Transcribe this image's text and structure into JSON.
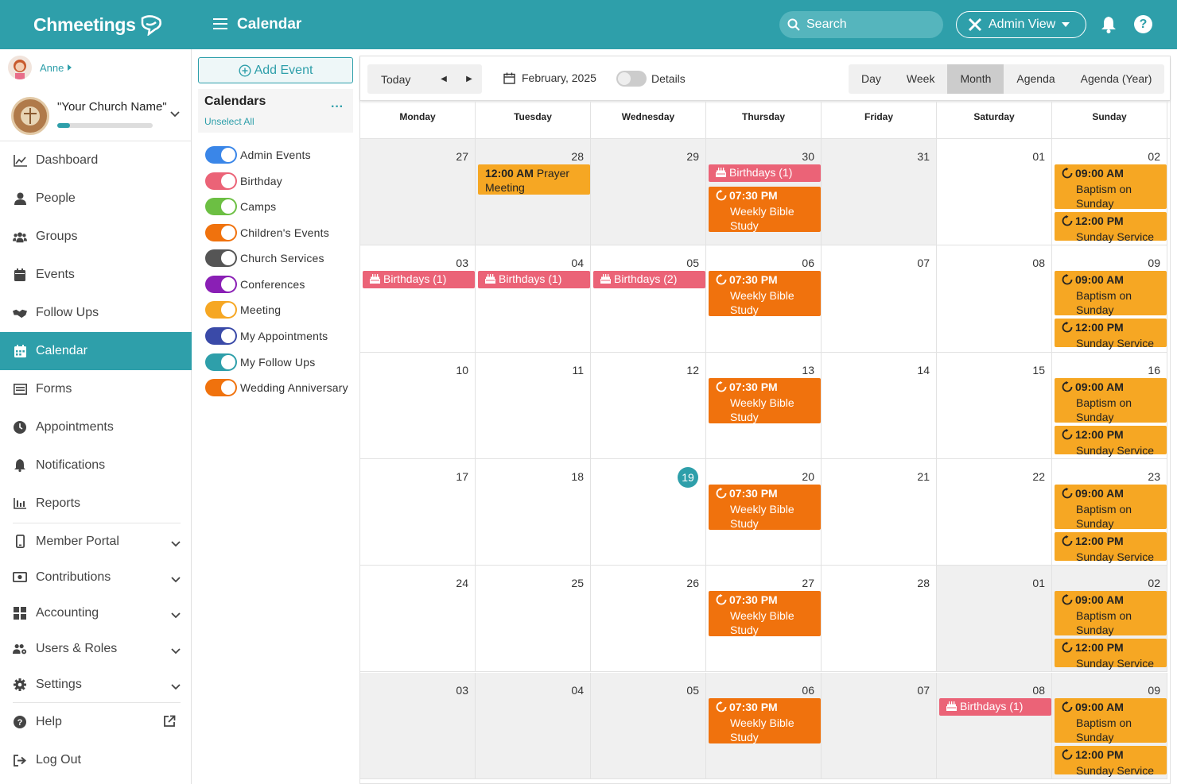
{
  "app": {
    "brand": "Chmeetings",
    "page_title": "Calendar"
  },
  "header": {
    "search_placeholder": "Search",
    "admin_view_label": "Admin View"
  },
  "user": {
    "name": "Anne"
  },
  "church": {
    "name": "\"Your Church Name\"",
    "progress": 0.13
  },
  "nav": [
    {
      "label": "Dashboard",
      "icon": "chart-line-icon"
    },
    {
      "label": "People",
      "icon": "person-icon"
    },
    {
      "label": "Groups",
      "icon": "people-group-icon"
    },
    {
      "label": "Events",
      "icon": "calendar-icon"
    },
    {
      "label": "Follow Ups",
      "icon": "handshake-icon"
    },
    {
      "label": "Calendar",
      "icon": "calendar-grid-icon",
      "active": true
    },
    {
      "label": "Forms",
      "icon": "form-list-icon"
    },
    {
      "label": "Appointments",
      "icon": "clock-icon"
    },
    {
      "label": "Notifications",
      "icon": "bell-icon"
    },
    {
      "label": "Reports",
      "icon": "bar-report-icon"
    },
    {
      "label": "Member Portal",
      "icon": "mobile-icon",
      "expandable": true
    },
    {
      "label": "Contributions",
      "icon": "money-icon",
      "expandable": true
    },
    {
      "label": "Accounting",
      "icon": "calculator-icon",
      "expandable": true
    },
    {
      "label": "Users & Roles",
      "icon": "users-cog-icon",
      "expandable": true
    },
    {
      "label": "Settings",
      "icon": "gear-icon",
      "expandable": true
    },
    {
      "label": "Help",
      "icon": "question-icon",
      "external": true
    },
    {
      "label": "Log Out",
      "icon": "logout-icon"
    }
  ],
  "calendars_panel": {
    "add_event_label": "Add Event",
    "title": "Calendars",
    "unselect_all": "Unselect All",
    "items": [
      {
        "label": "Admin Events",
        "color": "#3a86e8"
      },
      {
        "label": "Birthday",
        "color": "#eb6377"
      },
      {
        "label": "Camps",
        "color": "#6cbf43"
      },
      {
        "label": "Children's Events",
        "color": "#f0720d"
      },
      {
        "label": "Church Services",
        "color": "#555555"
      },
      {
        "label": "Conferences",
        "color": "#8a1fb5"
      },
      {
        "label": "Meeting",
        "color": "#f6a723"
      },
      {
        "label": "My Appointments",
        "color": "#3a4aa8"
      },
      {
        "label": "My Follow Ups",
        "color": "#2e9faa"
      },
      {
        "label": "Wedding Anniversary",
        "color": "#f0720d"
      }
    ]
  },
  "toolbar": {
    "today": "Today",
    "current_month": "February, 2025",
    "details_label": "Details",
    "views": [
      {
        "label": "Day"
      },
      {
        "label": "Week"
      },
      {
        "label": "Month",
        "active": true
      },
      {
        "label": "Agenda"
      },
      {
        "label": "Agenda (Year)"
      }
    ]
  },
  "weekdays": [
    "Monday",
    "Tuesday",
    "Wednesday",
    "Thursday",
    "Friday",
    "Saturday",
    "Sunday"
  ],
  "weeks": [
    {
      "days": [
        {
          "num": "27",
          "grey": true
        },
        {
          "num": "28",
          "grey": true,
          "events": [
            {
              "kind": "meet",
              "time": "12:00 AM",
              "title": "Prayer Meeting"
            }
          ]
        },
        {
          "num": "29",
          "grey": true
        },
        {
          "num": "30",
          "grey": true,
          "events": [
            {
              "kind": "pink",
              "title": "Birthdays (1)"
            },
            {
              "kind": "orange",
              "time": "07:30 PM",
              "title": "Weekly Bible Study"
            }
          ]
        },
        {
          "num": "31",
          "grey": true
        },
        {
          "num": "01"
        },
        {
          "num": "02",
          "events": [
            {
              "kind": "yellow",
              "time": "09:00 AM",
              "title": "Baptism on Sunday"
            },
            {
              "kind": "yellow",
              "time": "12:00 PM",
              "title": "Sunday Service"
            }
          ]
        }
      ]
    },
    {
      "days": [
        {
          "num": "03",
          "events": [
            {
              "kind": "pink",
              "title": "Birthdays (1)"
            }
          ]
        },
        {
          "num": "04",
          "events": [
            {
              "kind": "pink",
              "title": "Birthdays (1)"
            }
          ]
        },
        {
          "num": "05",
          "events": [
            {
              "kind": "pink",
              "title": "Birthdays (2)"
            }
          ]
        },
        {
          "num": "06",
          "events": [
            {
              "kind": "orange",
              "time": "07:30 PM",
              "title": "Weekly Bible Study"
            }
          ]
        },
        {
          "num": "07"
        },
        {
          "num": "08"
        },
        {
          "num": "09",
          "events": [
            {
              "kind": "yellow",
              "time": "09:00 AM",
              "title": "Baptism on Sunday"
            },
            {
              "kind": "yellow",
              "time": "12:00 PM",
              "title": "Sunday Service"
            }
          ]
        }
      ]
    },
    {
      "days": [
        {
          "num": "10"
        },
        {
          "num": "11"
        },
        {
          "num": "12"
        },
        {
          "num": "13",
          "events": [
            {
              "kind": "orange",
              "time": "07:30 PM",
              "title": "Weekly Bible Study"
            }
          ]
        },
        {
          "num": "14"
        },
        {
          "num": "15"
        },
        {
          "num": "16",
          "events": [
            {
              "kind": "yellow",
              "time": "09:00 AM",
              "title": "Baptism on Sunday"
            },
            {
              "kind": "yellow",
              "time": "12:00 PM",
              "title": "Sunday Service"
            }
          ]
        }
      ]
    },
    {
      "days": [
        {
          "num": "17"
        },
        {
          "num": "18"
        },
        {
          "num": "19",
          "today": true
        },
        {
          "num": "20",
          "events": [
            {
              "kind": "orange",
              "time": "07:30 PM",
              "title": "Weekly Bible Study"
            }
          ]
        },
        {
          "num": "21"
        },
        {
          "num": "22"
        },
        {
          "num": "23",
          "events": [
            {
              "kind": "yellow",
              "time": "09:00 AM",
              "title": "Baptism on Sunday"
            },
            {
              "kind": "yellow",
              "time": "12:00 PM",
              "title": "Sunday Service"
            }
          ]
        }
      ]
    },
    {
      "days": [
        {
          "num": "24"
        },
        {
          "num": "25"
        },
        {
          "num": "26"
        },
        {
          "num": "27",
          "events": [
            {
              "kind": "orange",
              "time": "07:30 PM",
              "title": "Weekly Bible Study"
            }
          ]
        },
        {
          "num": "28"
        },
        {
          "num": "01",
          "grey": true
        },
        {
          "num": "02",
          "grey": true,
          "events": [
            {
              "kind": "yellow",
              "time": "09:00 AM",
              "title": "Baptism on Sunday"
            },
            {
              "kind": "yellow",
              "time": "12:00 PM",
              "title": "Sunday Service"
            }
          ]
        }
      ]
    },
    {
      "days": [
        {
          "num": "03",
          "grey": true
        },
        {
          "num": "04",
          "grey": true
        },
        {
          "num": "05",
          "grey": true
        },
        {
          "num": "06",
          "grey": true,
          "events": [
            {
              "kind": "orange",
              "time": "07:30 PM",
              "title": "Weekly Bible Study"
            }
          ]
        },
        {
          "num": "07",
          "grey": true
        },
        {
          "num": "08",
          "grey": true,
          "events": [
            {
              "kind": "pink",
              "title": "Birthdays (1)"
            }
          ]
        },
        {
          "num": "09",
          "grey": true,
          "events": [
            {
              "kind": "yellow",
              "time": "09:00 AM",
              "title": "Baptism on Sunday"
            },
            {
              "kind": "yellow",
              "time": "12:00 PM",
              "title": "Sunday Service"
            }
          ]
        }
      ]
    }
  ],
  "colors": {
    "brand": "#2e9faa",
    "birthday": "#eb6377",
    "bible_study": "#f0720d",
    "service": "#f6a723"
  }
}
